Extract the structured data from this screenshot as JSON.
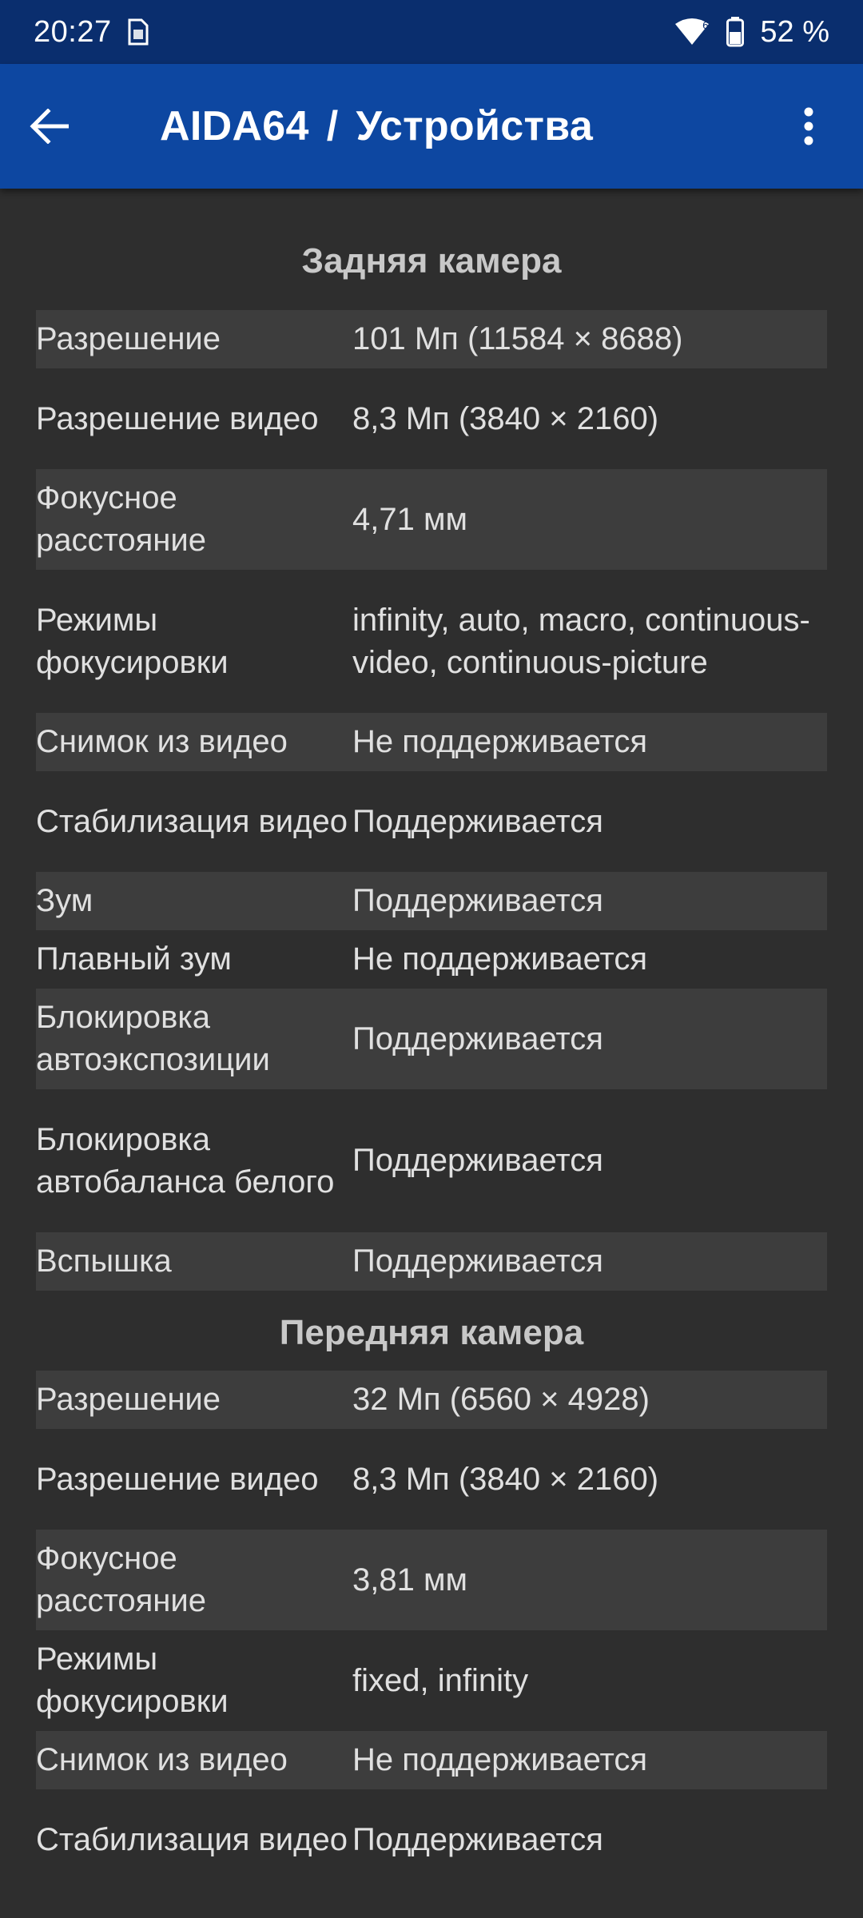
{
  "status_bar": {
    "time": "20:27",
    "network_badge": "6",
    "battery": "52 %"
  },
  "app_bar": {
    "app_name": "AIDA64",
    "separator": "/",
    "section": "Устройства"
  },
  "rear_camera": {
    "title": "Задняя камера",
    "rows": [
      {
        "label": "Разрешение",
        "value": "101 Мп (11584 × 8688)"
      },
      {
        "label": "Разрешение видео",
        "value": "8,3 Мп (3840 × 2160)"
      },
      {
        "label": "Фокусное расстояние",
        "value": "4,71 мм"
      },
      {
        "label": "Режимы фокусировки",
        "value": "infinity, auto, macro, continuous-video, continuous-picture"
      },
      {
        "label": "Снимок из видео",
        "value": "Не поддерживается"
      },
      {
        "label": "Стабилизация видео",
        "value": "Поддерживается"
      },
      {
        "label": "Зум",
        "value": "Поддерживается"
      },
      {
        "label": "Плавный зум",
        "value": "Не поддерживается"
      },
      {
        "label": "Блокировка автоэкспозиции",
        "value": "Поддерживается"
      },
      {
        "label": "Блокировка автобаланса белого",
        "value": "Поддерживается"
      },
      {
        "label": "Вспышка",
        "value": "Поддерживается"
      }
    ]
  },
  "front_camera": {
    "title": "Передняя камера",
    "rows": [
      {
        "label": "Разрешение",
        "value": "32 Мп (6560 × 4928)"
      },
      {
        "label": "Разрешение видео",
        "value": "8,3 Мп (3840 × 2160)"
      },
      {
        "label": "Фокусное расстояние",
        "value": "3,81 мм"
      },
      {
        "label": "Режимы фокусировки",
        "value": "fixed, infinity"
      },
      {
        "label": "Снимок из видео",
        "value": "Не поддерживается"
      },
      {
        "label": "Стабилизация видео",
        "value": "Поддерживается"
      }
    ]
  },
  "icons": {
    "back": "arrow-back-icon",
    "more": "more-vert-icon",
    "wifi": "wifi-icon",
    "battery": "battery-icon",
    "sim": "sim-card-icon"
  }
}
